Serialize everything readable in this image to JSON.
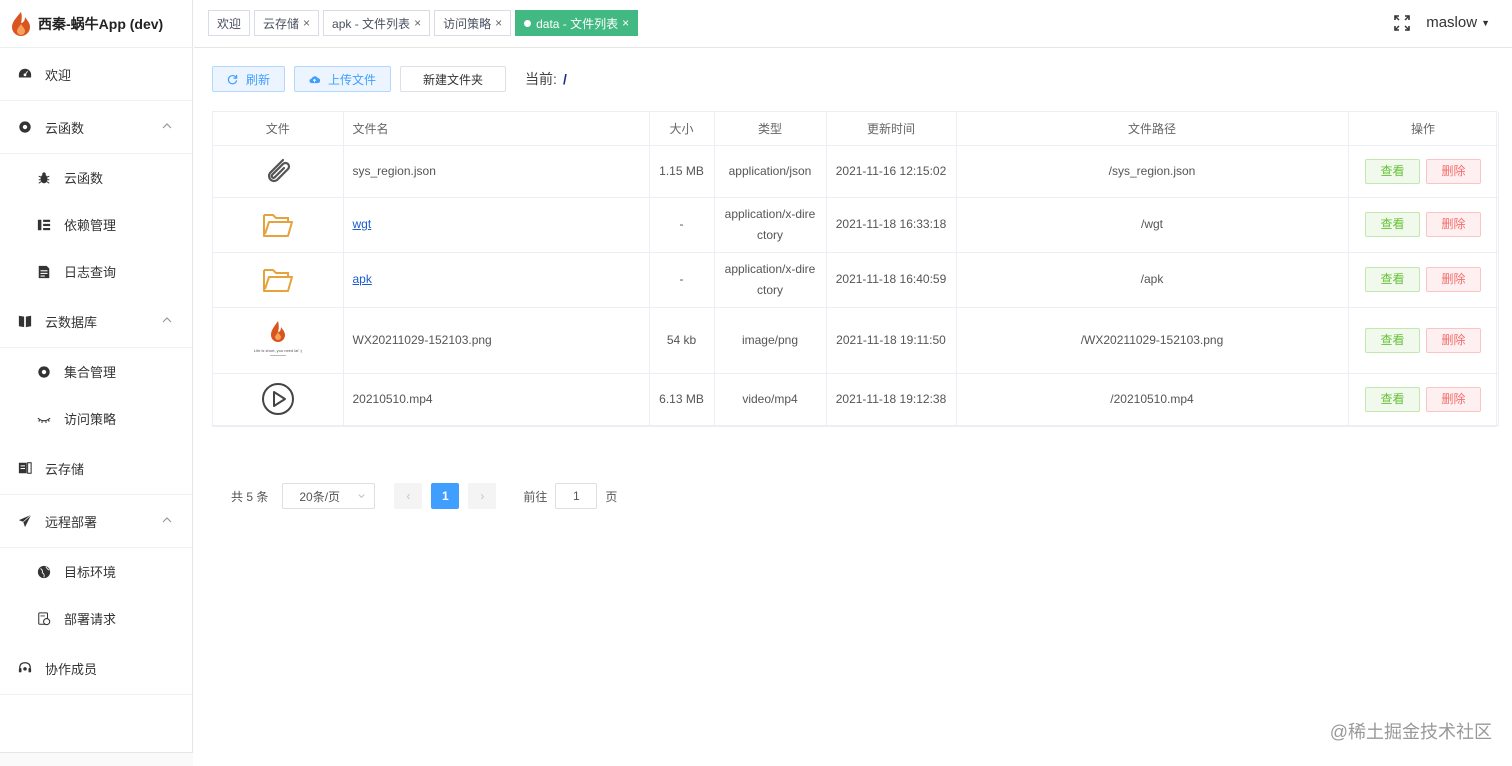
{
  "app": {
    "title": "西秦-蜗牛App (dev)"
  },
  "sidebar": {
    "dashboard": "欢迎",
    "cloud_functions": "云函数",
    "cloud_functions_items": [
      "云函数",
      "依赖管理",
      "日志查询"
    ],
    "database": "云数据库",
    "database_items": [
      "集合管理",
      "访问策略"
    ],
    "storage": "云存储",
    "deploy": "远程部署",
    "deploy_items": [
      "目标环境",
      "部署请求"
    ],
    "members": "协作成员"
  },
  "tabs": [
    {
      "label": "欢迎"
    },
    {
      "label": "云存储"
    },
    {
      "label": "apk - 文件列表"
    },
    {
      "label": "访问策略"
    },
    {
      "label": "data - 文件列表"
    }
  ],
  "tab_close": "×",
  "user": {
    "name": "maslow"
  },
  "toolbar": {
    "refresh": "刷新",
    "upload": "上传文件",
    "new_folder": "新建文件夹",
    "current_label": "当前:",
    "current_path": "/"
  },
  "table": {
    "headers": [
      "文件",
      "文件名",
      "大小",
      "类型",
      "更新时间",
      "文件路径",
      "操作"
    ],
    "view": "查看",
    "delete": "删除",
    "image_caption": "Life is short, you need laf :)",
    "rows": [
      {
        "icon": "paperclip-icon",
        "name": "sys_region.json",
        "size": "1.15 MB",
        "type": "application/json",
        "updated": "2021-11-16 12:15:02",
        "path": "/sys_region.json"
      },
      {
        "icon": "folder-icon",
        "name": "wgt",
        "size": "-",
        "type": "application/x-directory",
        "updated": "2021-11-18 16:33:18",
        "path": "/wgt"
      },
      {
        "icon": "folder-icon",
        "name": "apk",
        "size": "-",
        "type": "application/x-directory",
        "updated": "2021-11-18 16:40:59",
        "path": "/apk"
      },
      {
        "icon": "image-thumbnail",
        "name": "WX20211029-152103.png",
        "size": "54 kb",
        "type": "image/png",
        "updated": "2021-11-18 19:11:50",
        "path": "/WX20211029-152103.png"
      },
      {
        "icon": "play-icon",
        "name": "20210510.mp4",
        "size": "6.13 MB",
        "type": "video/mp4",
        "updated": "2021-11-18 19:12:38",
        "path": "/20210510.mp4"
      }
    ]
  },
  "pager": {
    "total": "共 5 条",
    "page_size": "20条/页",
    "prev": "‹",
    "current": "1",
    "next": "›",
    "goto_label": "前往",
    "goto_value": "1",
    "page_suffix": "页"
  },
  "watermark": "@稀土掘金技术社区",
  "colors": {
    "accent": "#409eff",
    "active_tab": "#42b983",
    "folder": "#e6a23c",
    "success": "#67c23a",
    "danger": "#f56c6c"
  }
}
